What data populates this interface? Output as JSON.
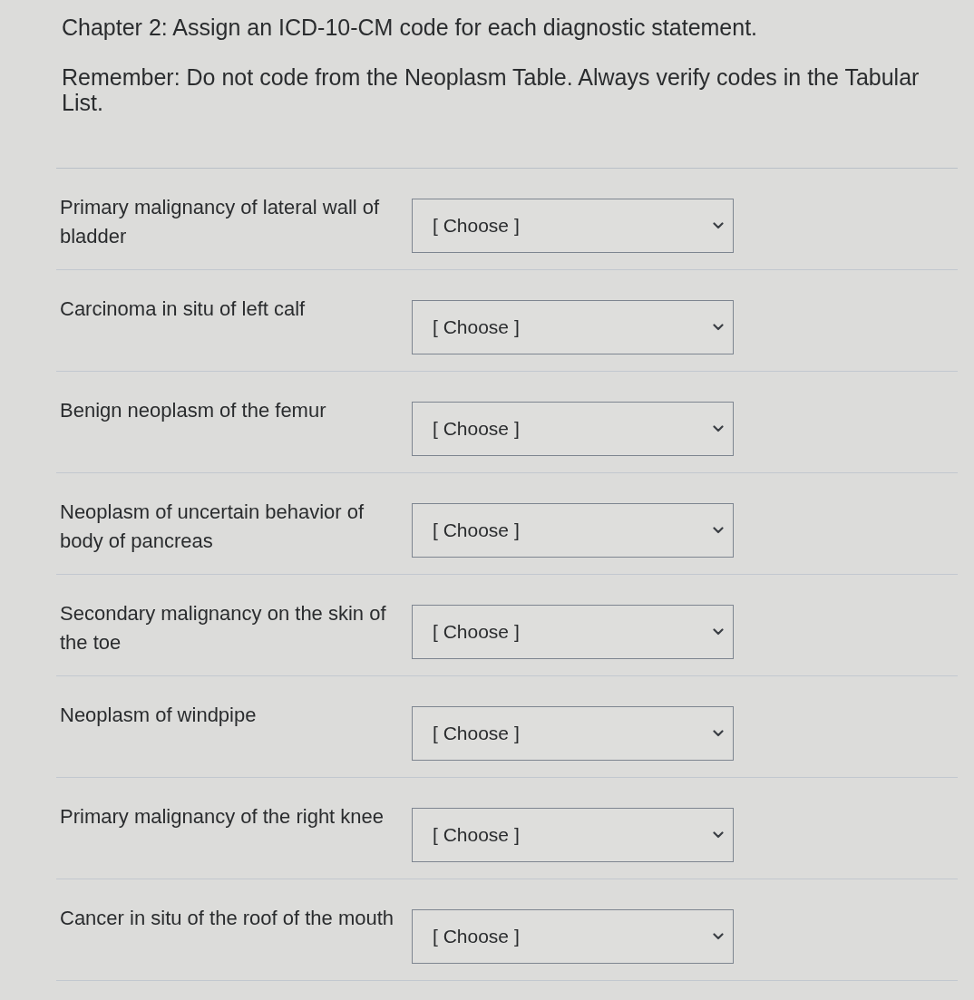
{
  "title": "Chapter 2: Assign an ICD-10-CM code for each diagnostic statement.",
  "instructions": "Remember: Do not code from the Neoplasm Table. Always verify codes in the Tabular List.",
  "questions": [
    {
      "statement": "Primary malignancy of lateral wall of bladder",
      "answer": {
        "value": "[ Choose ]"
      }
    },
    {
      "statement": "Carcinoma in situ of left calf",
      "answer": {
        "value": "[ Choose ]"
      }
    },
    {
      "statement": "Benign neoplasm of the femur",
      "answer": {
        "value": "[ Choose ]"
      }
    },
    {
      "statement": "Neoplasm of uncertain behavior of body of pancreas",
      "answer": {
        "value": "[ Choose ]"
      }
    },
    {
      "statement": "Secondary malignancy on the skin of the toe",
      "answer": {
        "value": "[ Choose ]"
      }
    },
    {
      "statement": "Neoplasm of windpipe",
      "answer": {
        "value": "[ Choose ]"
      }
    },
    {
      "statement": "Primary malignancy of the right knee",
      "answer": {
        "value": "[ Choose ]"
      }
    },
    {
      "statement": "Cancer in situ of the roof of the mouth",
      "answer": {
        "value": "[ Choose ]"
      }
    }
  ]
}
